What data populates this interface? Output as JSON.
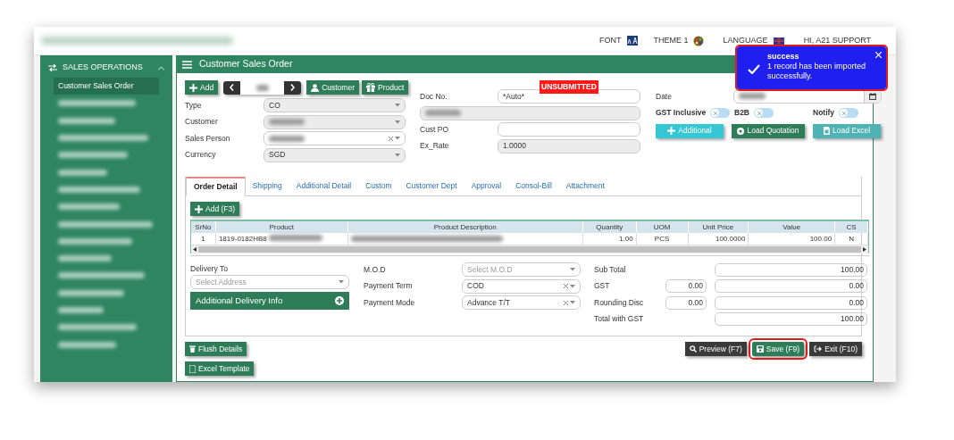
{
  "top_bar": {
    "font_label": "FONT",
    "theme_label": "THEME 1",
    "language_label": "LANGUAGE",
    "user_label": "HI, A21 SUPPORT"
  },
  "toast": {
    "title": "success",
    "message": "1 record has been imported successfully."
  },
  "sidebar": {
    "title": "SALES OPERATIONS",
    "expanded": true,
    "items": [
      {
        "label": "Customer Sales Order",
        "selected": true
      },
      {
        "redacted": true,
        "selected": false
      },
      {
        "redacted": true,
        "selected": false
      },
      {
        "redacted": true,
        "selected": false
      },
      {
        "redacted": true,
        "selected": false
      },
      {
        "redacted": true,
        "selected": false
      },
      {
        "redacted": true,
        "selected": false
      },
      {
        "redacted": true,
        "selected": false
      },
      {
        "redacted": true,
        "selected": false
      },
      {
        "redacted": true,
        "selected": false
      },
      {
        "redacted": true,
        "selected": false
      },
      {
        "redacted": true,
        "selected": false
      },
      {
        "redacted": true,
        "selected": false
      },
      {
        "redacted": true,
        "selected": false
      },
      {
        "redacted": true,
        "selected": false
      },
      {
        "redacted": true,
        "selected": false
      }
    ]
  },
  "page_title": "Customer Sales Order",
  "toolbar": {
    "add": "Add",
    "customer": "Customer",
    "product": "Product",
    "record_redacted": true
  },
  "status_badge": "UNSUBMITTED",
  "left_fields": [
    {
      "label": "Type",
      "value": "CO",
      "clearable": false,
      "readonly": true
    },
    {
      "label": "Customer",
      "clearable": false,
      "readonly": true,
      "redacted": true
    },
    {
      "label": "Sales Person",
      "clearable": true,
      "readonly": false,
      "redacted": true
    },
    {
      "label": "Currency",
      "value": "SGD",
      "clearable": false,
      "readonly": true
    }
  ],
  "mid_fields": [
    {
      "label": "Doc No.",
      "value": "*Auto*",
      "readonly": false
    },
    {
      "readonly": true,
      "redacted": true
    },
    {
      "label": "Cust PO",
      "readonly": false
    },
    {
      "label": "Ex_Rate",
      "value": "1.0000",
      "readonly": true
    }
  ],
  "date": {
    "label": "Date",
    "redacted": true
  },
  "toggles": [
    {
      "label": "GST Inclusive",
      "on": false
    },
    {
      "label": "B2B",
      "on": false
    },
    {
      "label": "Notify",
      "on": false
    }
  ],
  "action_buttons": [
    {
      "label": "Additional",
      "kind": "additional"
    },
    {
      "label": "Load Quotation",
      "kind": "quotation"
    },
    {
      "label": "Load Excel",
      "kind": "excel"
    }
  ],
  "tabs": [
    {
      "label": "Order Detail",
      "selected": true
    },
    {
      "label": "Shipping",
      "selected": false
    },
    {
      "label": "Additional Detail",
      "selected": false
    },
    {
      "label": "Custom",
      "selected": false
    },
    {
      "label": "Customer Dept",
      "selected": false
    },
    {
      "label": "Approval",
      "selected": false
    },
    {
      "label": "Consol-Bill",
      "selected": false
    },
    {
      "label": "Attachment",
      "selected": false
    }
  ],
  "add_line": "Add (F3)",
  "table": {
    "columns": [
      "SrNo",
      "Product",
      "Product Description",
      "Quantity",
      "UOM",
      "Unit Price",
      "Value",
      "CS"
    ],
    "rows": [
      {
        "cells": [
          "1",
          "1819-0182HB8",
          null,
          "1.00",
          "PCS",
          "100.0000",
          "100.00",
          "N"
        ],
        "redacted": true
      }
    ]
  },
  "delivery": {
    "label": "Delivery To",
    "placeholder": "Select Address",
    "info_button": "Additional Delivery Info"
  },
  "payment_fields": [
    {
      "label": "M.O.D",
      "placeholder": "Select M.O.D",
      "clearable": false
    },
    {
      "label": "Payment Term",
      "value": "COD",
      "clearable": true
    },
    {
      "label": "Payment Mode",
      "value": "Advance T/T",
      "clearable": true
    }
  ],
  "totals": [
    {
      "label": "Sub Total",
      "amount": "100.00"
    },
    {
      "label": "GST",
      "rate": "0.00",
      "amount": "0.00"
    },
    {
      "label": "Rounding Disc",
      "rate": "0.00",
      "amount": "0.00"
    },
    {
      "label": "Total with GST",
      "amount": "100.00"
    }
  ],
  "bottom_left_buttons": [
    {
      "label": "Flush Details",
      "kind": "trash"
    },
    {
      "label": "Excel Template",
      "kind": "file"
    }
  ],
  "bottom_right_buttons": [
    {
      "label": "Preview (F7)",
      "kind": "preview",
      "highlighted": false
    },
    {
      "label": "Save (F9)",
      "kind": "save",
      "highlighted": true
    },
    {
      "label": "Exit (F10)",
      "kind": "exit",
      "highlighted": false
    }
  ]
}
